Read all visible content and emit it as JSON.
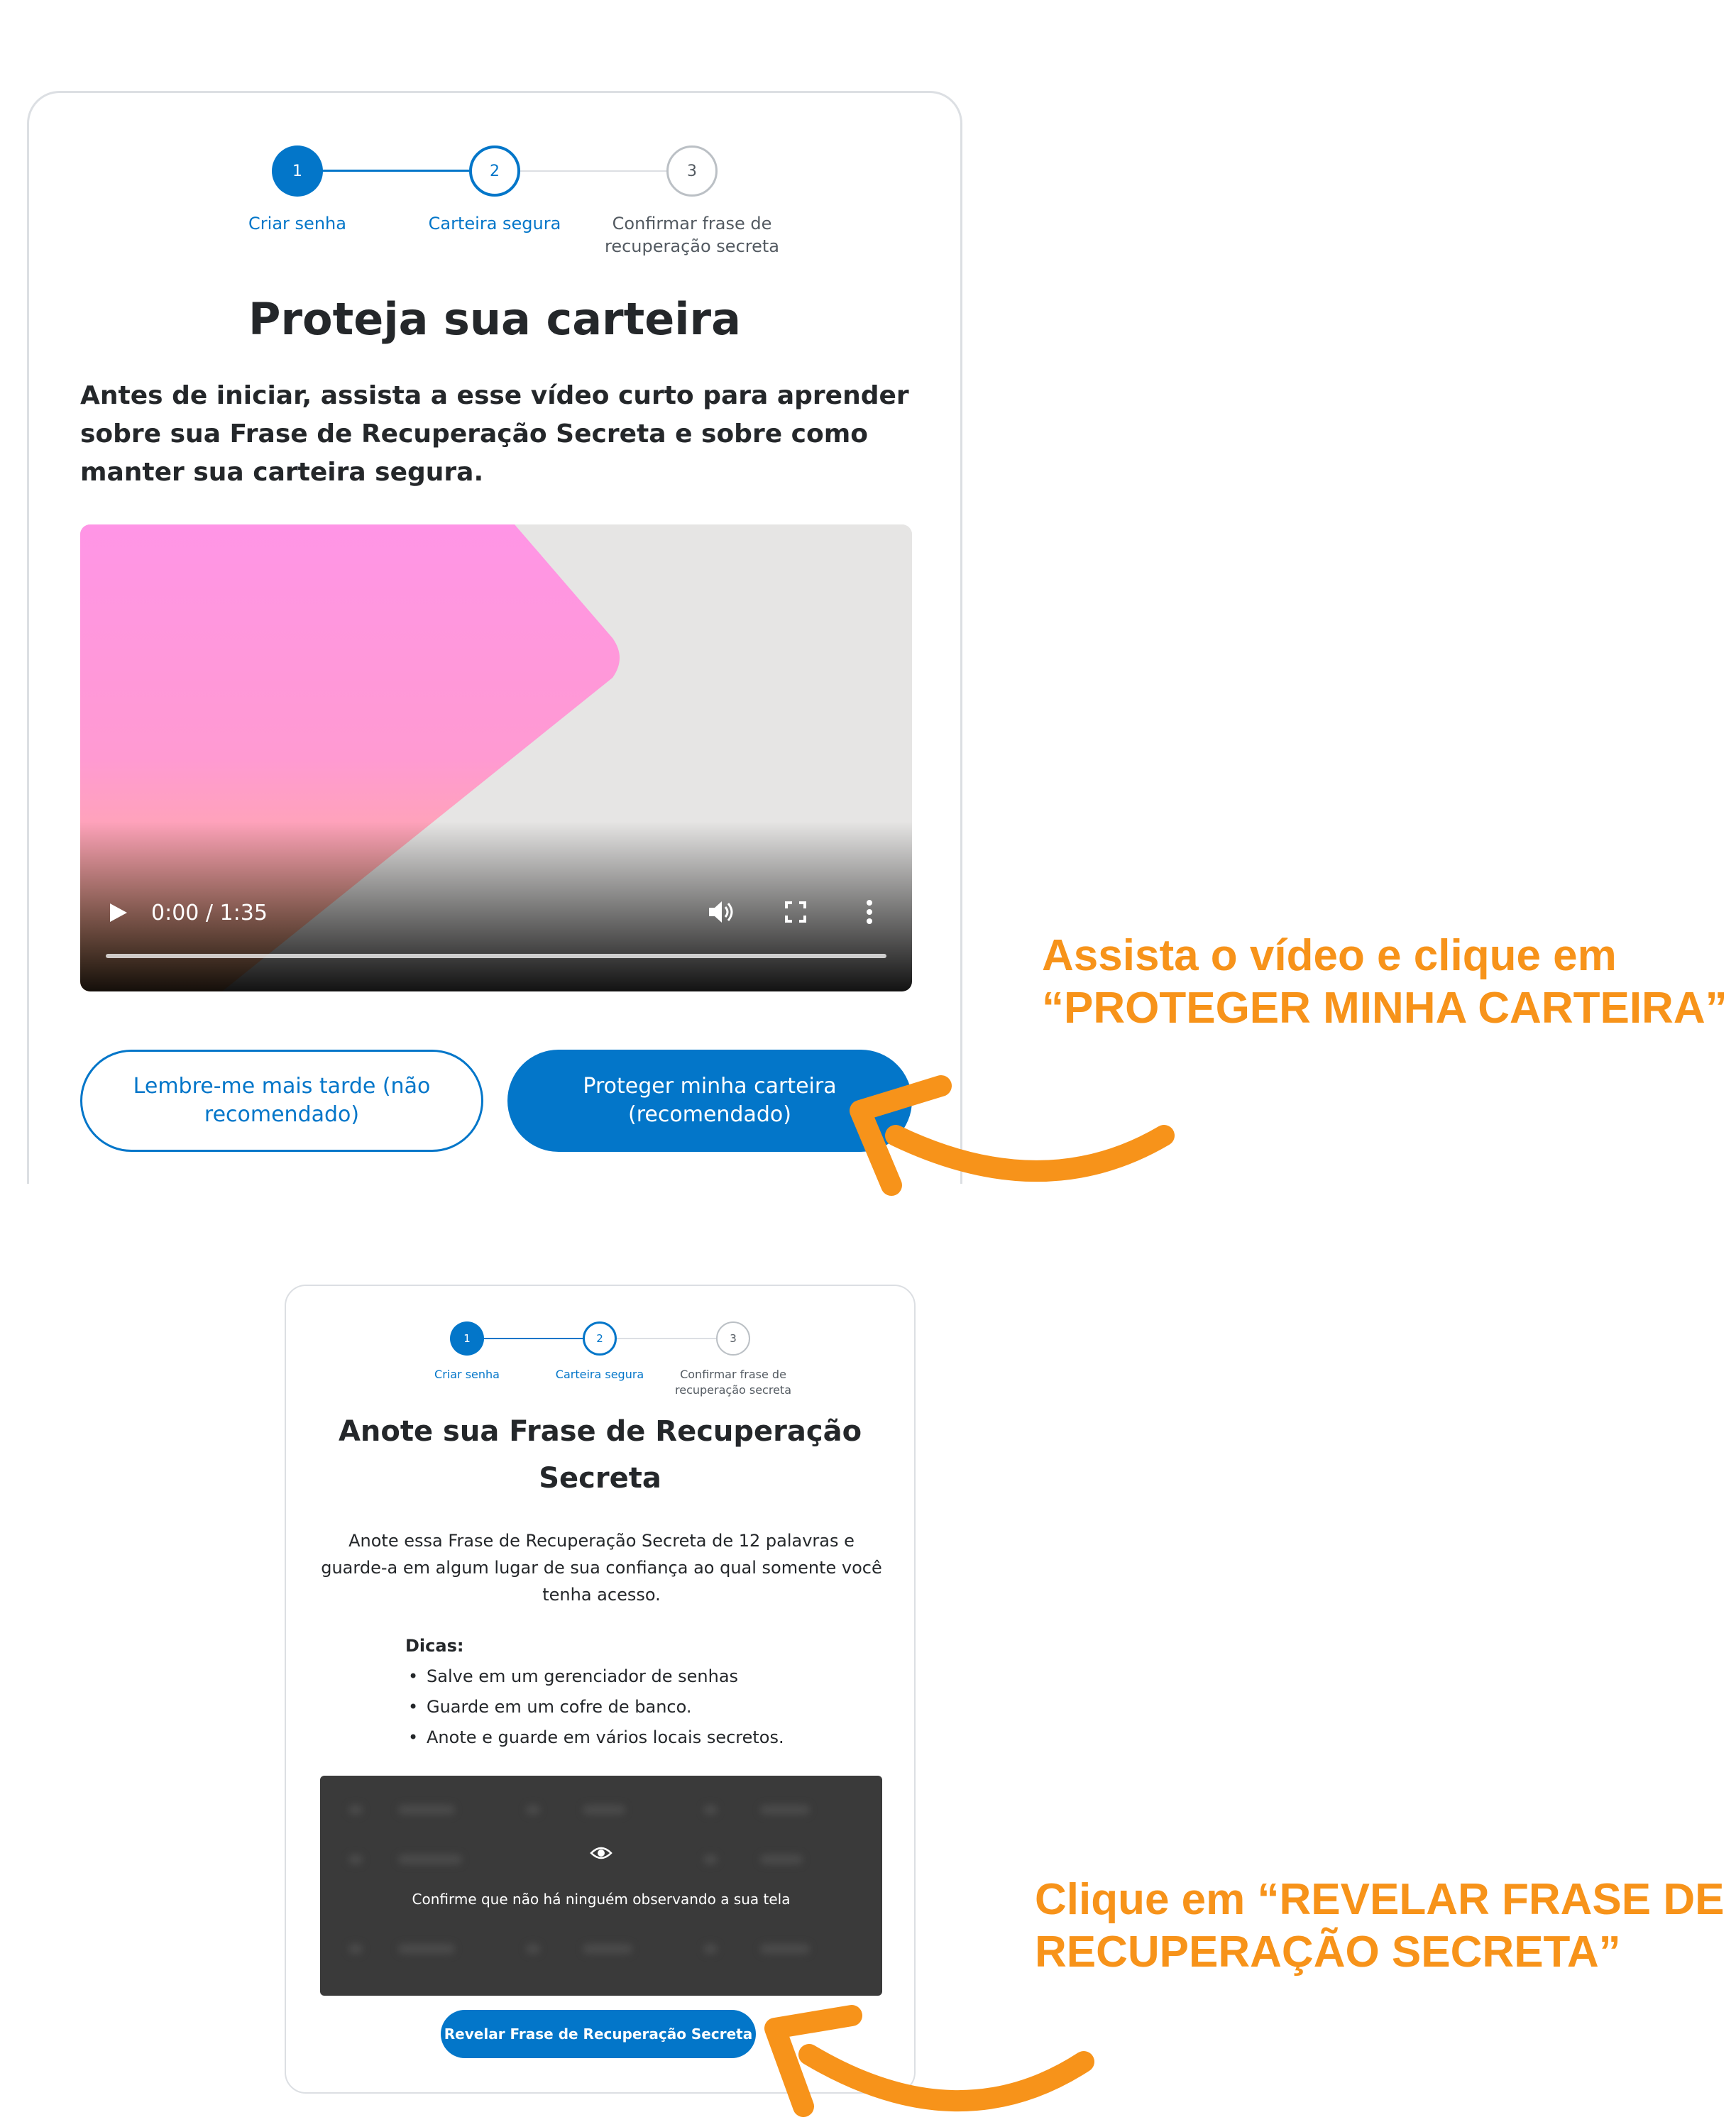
{
  "colors": {
    "accent": "#0376c9",
    "text": "#24272a",
    "annotation": "#f7931a",
    "reveal_overlay": "#3a3a3a",
    "inactive_step": "#bbc0c5"
  },
  "panel1": {
    "stepper": {
      "steps": [
        {
          "number": "1",
          "label": "Criar senha",
          "state": "complete"
        },
        {
          "number": "2",
          "label": "Carteira segura",
          "state": "active"
        },
        {
          "number": "3",
          "label": "Confirmar frase de recuperação secreta",
          "state": "pending"
        }
      ]
    },
    "title": "Proteja sua carteira",
    "intro": "Antes de iniciar, assista a esse vídeo curto para aprender sobre sua Frase de Recuperação Secreta e sobre como manter sua carteira segura.",
    "video": {
      "time": "0:00 / 1:35",
      "progress": 0,
      "icons": {
        "play": "play-icon",
        "volume": "volume-icon",
        "fullscreen": "fullscreen-icon",
        "menu": "more-vertical-icon"
      }
    },
    "buttons": {
      "remind_later": "Lembre-me mais tarde (não recomendado)",
      "secure_wallet": "Proteger minha carteira (recomendado)"
    }
  },
  "panel2": {
    "stepper": {
      "steps": [
        {
          "number": "1",
          "label": "Criar senha",
          "state": "complete"
        },
        {
          "number": "2",
          "label": "Carteira segura",
          "state": "active"
        },
        {
          "number": "3",
          "label": "Confirmar frase de recuperação secreta",
          "state": "pending"
        }
      ]
    },
    "title": "Anote sua Frase de Recuperação Secreta",
    "description": "Anote essa Frase de Recuperação Secreta de 12 palavras e guarde-a em algum lugar de sua confiança ao qual somente você tenha acesso.",
    "tips": {
      "heading": "Dicas:",
      "items": [
        "Salve em um gerenciador de senhas",
        "Guarde em um cofre de banco.",
        "Anote e guarde em vários locais secretos."
      ]
    },
    "srp_overlay": {
      "warning": "Confirme que não há ninguém observando a sua tela",
      "icon": "eye-icon"
    },
    "reveal_button": "Revelar Frase de Recuperação Secreta"
  },
  "annotations": {
    "first": [
      "Assista o vídeo e clique em",
      "“PROTEGER MINHA CARTEIRA”"
    ],
    "second": [
      "Clique em “REVELAR FRASE DE",
      "RECUPERAÇÃO SECRETA”"
    ]
  }
}
